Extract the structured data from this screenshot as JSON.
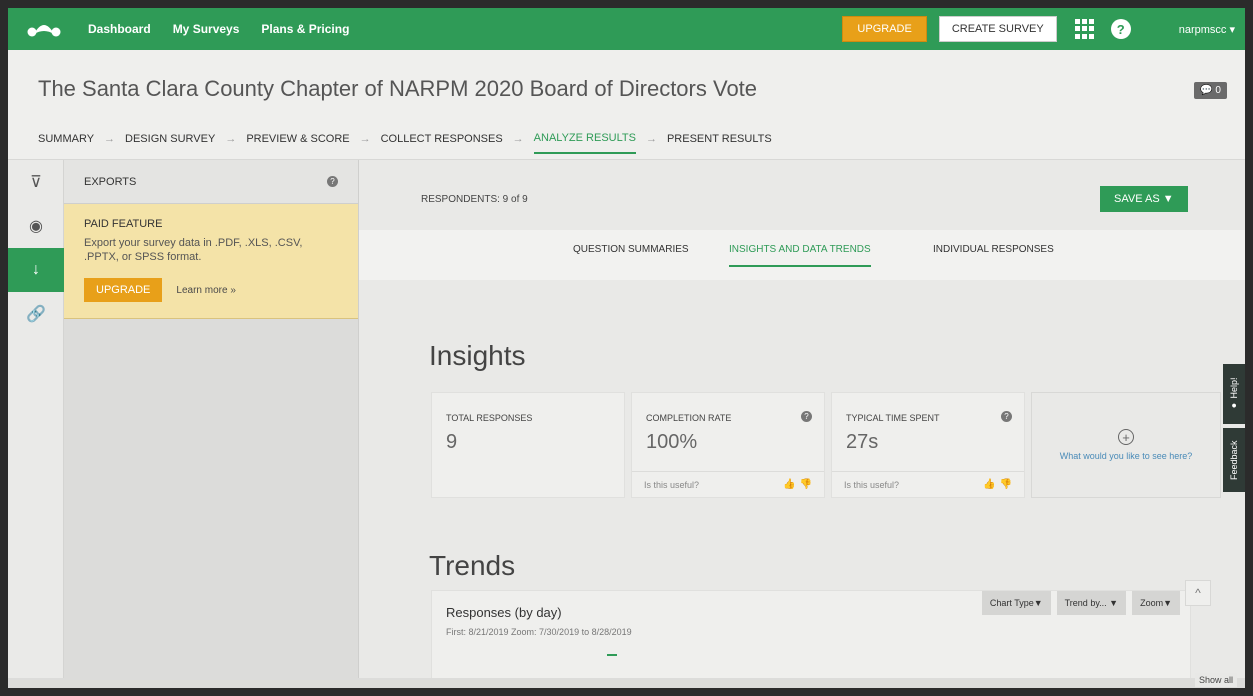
{
  "nav": {
    "logo_icon": "surveymonkey-logo-icon",
    "links": [
      "Dashboard",
      "My Surveys",
      "Plans & Pricing"
    ],
    "upgrade_label": "UPGRADE",
    "create_label": "CREATE SURVEY",
    "help_label": "?",
    "user": "narpmscc ▾"
  },
  "header": {
    "title": "The Santa Clara County Chapter of NARPM 2020 Board of Directors Vote",
    "comments": "💬 0",
    "steps": [
      "SUMMARY",
      "DESIGN SURVEY",
      "PREVIEW & SCORE",
      "COLLECT RESPONSES",
      "ANALYZE RESULTS",
      "PRESENT RESULTS"
    ],
    "active_step": "ANALYZE RESULTS"
  },
  "rail": {
    "icons": [
      "filter-icon",
      "eye-icon",
      "download-icon",
      "link-icon"
    ],
    "glyphs": [
      "⊽",
      "◉",
      "↓",
      "🔗"
    ]
  },
  "exports": {
    "title": "EXPORTS",
    "paid_title": "PAID FEATURE",
    "paid_desc": "Export your survey data in .PDF, .XLS, .CSV, .PPTX, or SPSS format.",
    "upgrade_label": "UPGRADE",
    "learn_more": "Learn more »"
  },
  "main": {
    "respondents": "RESPONDENTS: 9 of 9",
    "save_as": "SAVE AS ▼",
    "tabs": [
      "QUESTION SUMMARIES",
      "INSIGHTS AND DATA TRENDS",
      "INDIVIDUAL RESPONSES"
    ],
    "active_tab": "INSIGHTS AND DATA TRENDS",
    "insights_title": "Insights",
    "cards": [
      {
        "label": "TOTAL RESPONSES",
        "value": "9"
      },
      {
        "label": "COMPLETION RATE",
        "value": "100%",
        "useful": "Is this useful?"
      },
      {
        "label": "TYPICAL TIME SPENT",
        "value": "27s",
        "useful": "Is this useful?"
      }
    ],
    "add_card_text": "What would you like to see here?",
    "trends_title": "Trends",
    "trend": {
      "title": "Responses (by day)",
      "sub": "First: 8/21/2019    Zoom: 7/30/2019 to 8/28/2019",
      "controls": [
        "Chart Type▼",
        "Trend by... ▼",
        "Zoom▼"
      ]
    }
  },
  "side_tabs": {
    "help": "● Help!",
    "feedback": "Feedback"
  },
  "footer": {
    "show_all": "Show all"
  }
}
